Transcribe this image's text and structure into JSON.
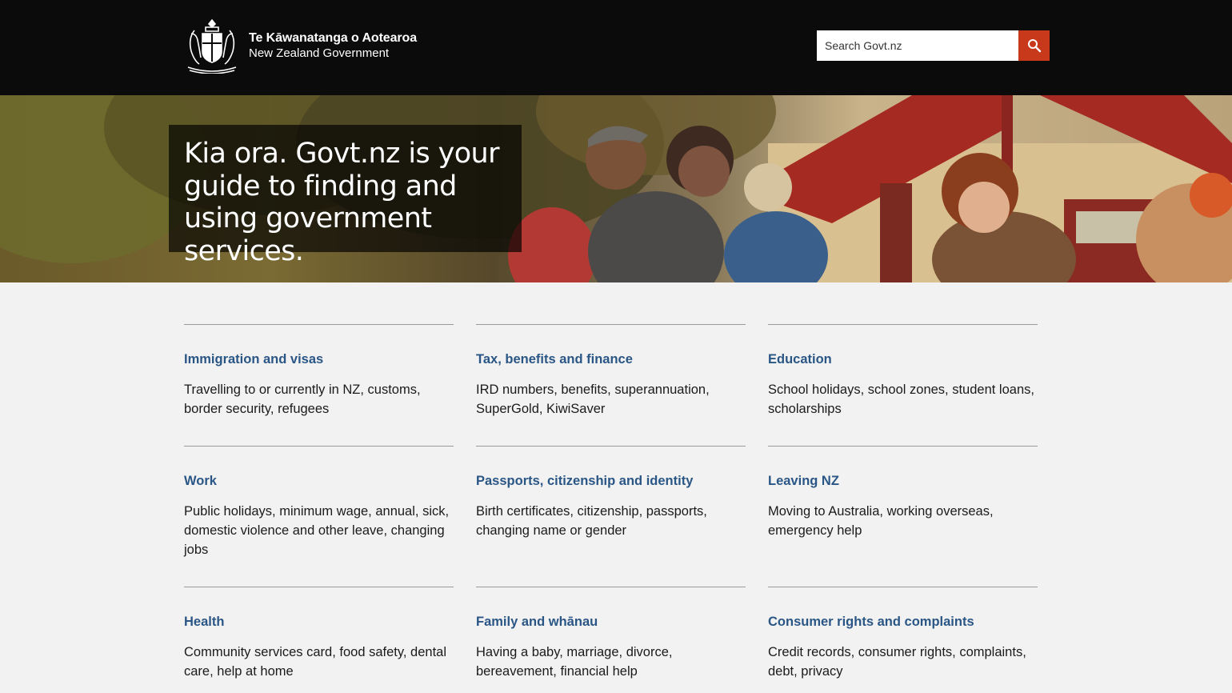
{
  "header": {
    "logo": {
      "line1": "Te Kāwanatanga o Aotearoa",
      "line2": "New Zealand Government"
    },
    "search": {
      "placeholder": "Search Govt.nz",
      "button_icon": "search-icon"
    }
  },
  "hero": {
    "heading": "Kia ora. Govt.nz is your guide to finding and using government services."
  },
  "topics": [
    {
      "title": "Immigration and visas",
      "description": "Travelling to or currently in NZ, customs, border security, refugees"
    },
    {
      "title": "Tax, benefits and finance",
      "description": "IRD numbers, benefits, superannuation, SuperGold, KiwiSaver"
    },
    {
      "title": "Education",
      "description": "School holidays, school zones, student loans, scholarships"
    },
    {
      "title": "Work",
      "description": "Public holidays, minimum wage, annual, sick, domestic violence and other leave, changing jobs"
    },
    {
      "title": "Passports, citizenship and identity",
      "description": "Birth certificates, citizenship, passports, changing name or gender"
    },
    {
      "title": "Leaving NZ",
      "description": "Moving to Australia, working overseas, emergency help"
    },
    {
      "title": "Health",
      "description": "Community services card, food safety, dental care, help at home"
    },
    {
      "title": "Family and whānau",
      "description": "Having a baby, marriage, divorce, bereavement, financial help"
    },
    {
      "title": "Consumer rights and complaints",
      "description": "Credit records, consumer rights, complaints, debt, privacy"
    }
  ],
  "colors": {
    "header_bg": "#0b0b0b",
    "search_button": "#c8391c",
    "link": "#2a5686",
    "page_bg": "#f2f2f2"
  }
}
